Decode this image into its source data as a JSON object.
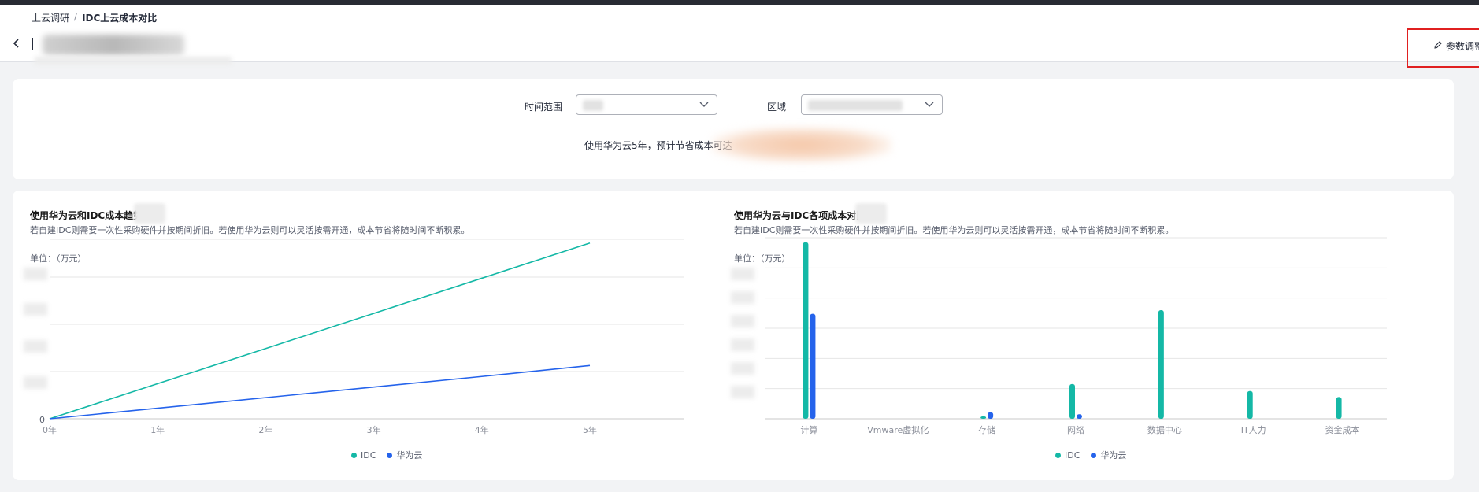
{
  "breadcrumb": {
    "parent": "上云调研",
    "separator": "/",
    "current": "IDC上云成本对比"
  },
  "header": {
    "adjust_label": "参数调整"
  },
  "filters": {
    "time_range_label": "时间范围",
    "region_label": "区域"
  },
  "savings": {
    "text": "使用华为云5年，预计节省成本可达"
  },
  "colors": {
    "idc": "#14b8a6",
    "huawei": "#2563eb",
    "highlight_border": "#e02020"
  },
  "trend_panel": {
    "title": "使用华为云和IDC成本趋势",
    "description": "若自建IDC则需要一次性采购硬件并按期间折旧。若使用华为云则可以灵活按需开通，成本节省将随时间不断积累。",
    "unit": "单位：（万元）",
    "y_zero": "0",
    "legend": [
      "IDC",
      "华为云"
    ]
  },
  "compare_panel": {
    "title": "使用华为云与IDC各项成本对比",
    "description": "若自建IDC则需要一次性采购硬件并按期间折旧。若使用华为云则可以灵活按需开通，成本节省将随时间不断积累。",
    "unit": "单位：（万元）",
    "legend": [
      "IDC",
      "华为云"
    ]
  },
  "chart_data": [
    {
      "type": "line",
      "x": [
        "0年",
        "1年",
        "2年",
        "3年",
        "4年",
        "5年"
      ],
      "series": [
        {
          "name": "IDC",
          "values": [
            0,
            0.93,
            1.86,
            2.79,
            3.72,
            4.65
          ]
        },
        {
          "name": "华为云",
          "values": [
            0,
            0.28,
            0.56,
            0.84,
            1.12,
            1.41
          ]
        }
      ],
      "ylim": [
        0,
        5
      ],
      "grid": true,
      "legend_position": "bottom-center"
    },
    {
      "type": "bar",
      "categories": [
        "计算",
        "Vmware虚拟化",
        "存储",
        "网络",
        "数据中心",
        "IT人力",
        "资金成本"
      ],
      "series": [
        {
          "name": "IDC",
          "values": [
            5.85,
            0,
            0.08,
            1.15,
            3.6,
            0.92,
            0.72
          ]
        },
        {
          "name": "华为云",
          "values": [
            3.48,
            0,
            0.22,
            0.15,
            0,
            0,
            0
          ]
        }
      ],
      "ylim": [
        0,
        6
      ],
      "grid": true,
      "legend_position": "bottom-center"
    }
  ]
}
